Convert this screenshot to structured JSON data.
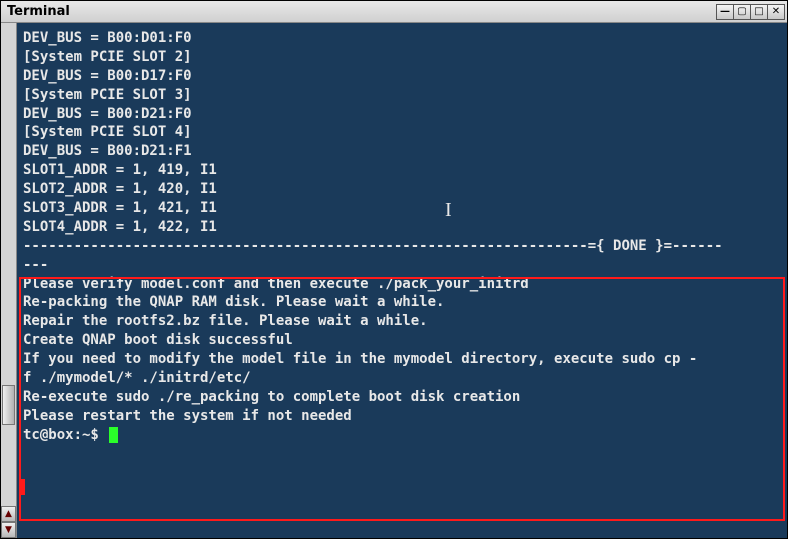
{
  "window": {
    "title": "Terminal"
  },
  "terminal": {
    "lines": [
      "DEV_BUS = B00:D01:F0",
      "[System PCIE SLOT 2]",
      "DEV_BUS = B00:D17:F0",
      "[System PCIE SLOT 3]",
      "DEV_BUS = B00:D21:F0",
      "[System PCIE SLOT 4]",
      "DEV_BUS = B00:D21:F1",
      "SLOT1_ADDR = 1, 419, I1",
      "SLOT2_ADDR = 1, 420, I1",
      "SLOT3_ADDR = 1, 421, I1",
      "SLOT4_ADDR = 1, 422, I1",
      "-------------------------------------------------------------------={ DONE }=------",
      "---",
      "Please verify model.conf and then execute ./pack_your_initrd",
      "Re-packing the QNAP RAM disk. Please wait a while.",
      "Repair the rootfs2.bz file. Please wait a while.",
      "",
      "Create QNAP boot disk successful",
      "If you need to modify the model file in the mymodel directory, execute sudo cp -",
      "f ./mymodel/* ./initrd/etc/",
      "Re-execute sudo ./re_packing to complete boot disk creation",
      "Please restart the system if not needed"
    ],
    "prompt": "tc@box:~$ "
  }
}
